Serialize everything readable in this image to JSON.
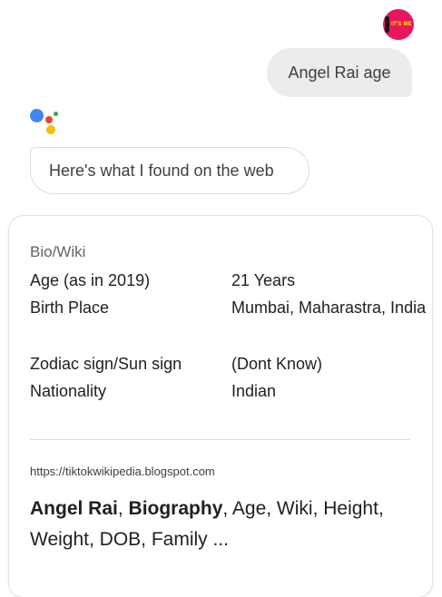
{
  "user": {
    "avatar_text": "IT'S ME",
    "query": "Angel Rai age"
  },
  "assistant": {
    "logo_colors": [
      "#4285f4",
      "#ea4335",
      "#34a853",
      "#fbbc05"
    ],
    "reply": "Here's what I found on the web"
  },
  "card": {
    "heading": "Bio/Wiki",
    "rows": [
      {
        "label": "Age (as in 2019)",
        "value": "21 Years"
      },
      {
        "label": "Birth Place",
        "value": "Mumbai, Maharastra, India"
      },
      {
        "label": "Zodiac sign/Sun sign",
        "value": "(Dont Know)"
      },
      {
        "label": "Nationality",
        "value": "Indian"
      }
    ],
    "source_url": "https://tiktokwikipedia.blogspot.com",
    "title_parts": {
      "bold1": "Angel Rai",
      "sep1": ", ",
      "bold2": "Biography",
      "rest": ", Age, Wiki, Height, Weight, DOB, Family ..."
    }
  }
}
